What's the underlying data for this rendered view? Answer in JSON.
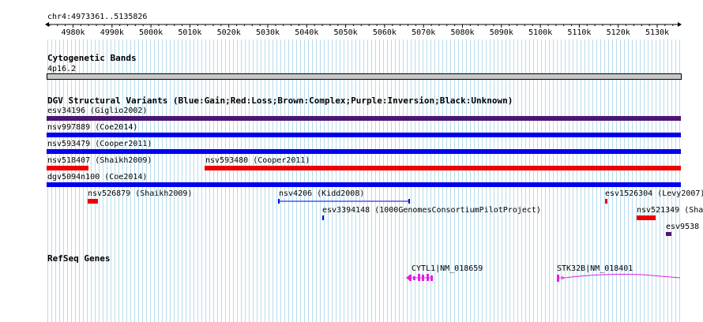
{
  "ruler": {
    "range_label": "chr4:4973361..5135826",
    "ticks": [
      "4980k",
      "4990k",
      "5000k",
      "5010k",
      "5020k",
      "5030k",
      "5040k",
      "5050k",
      "5060k",
      "5070k",
      "5080k",
      "5090k",
      "5100k",
      "5110k",
      "5120k",
      "5130k"
    ]
  },
  "cytoband": {
    "title": "Cytogenetic Bands",
    "band": "4p16.2"
  },
  "dgv": {
    "title": "DGV Structural Variants (Blue:Gain;Red:Loss;Brown:Complex;Purple:Inversion;Black:Unknown)",
    "variants": [
      {
        "label": "esv34196 (Giglio2002)",
        "color": "#4b1673"
      },
      {
        "label": "nsv997889 (Coe2014)",
        "color": "#0000ee"
      },
      {
        "label": "nsv593479 (Cooper2011)",
        "color": "#0000ee"
      },
      {
        "label": "nsv518407 (Shaikh2009)",
        "color": "#ee0000"
      },
      {
        "label": "nsv593480 (Cooper2011)",
        "color": "#ee0000"
      },
      {
        "label": "dgv5094n100 (Coe2014)",
        "color": "#0000ee"
      },
      {
        "label": "nsv526879 (Shaikh2009)",
        "color": "#ee0000"
      },
      {
        "label": "nsv4206 (Kidd2008)",
        "color": "#0000ee"
      },
      {
        "label": "esv1526304 (Levy2007)",
        "color": "#ee0000"
      },
      {
        "label": "esv3394148 (1000GenomesConsortiumPilotProject)",
        "color": "#0000ee"
      },
      {
        "label": "nsv521349 (Sha",
        "color": "#ee0000"
      },
      {
        "label": "esv9538",
        "color": "#4b1673"
      }
    ]
  },
  "refseq": {
    "title": "RefSeq Genes",
    "genes": [
      {
        "label": "CYTL1|NM_018659",
        "color": "#e020e0"
      },
      {
        "label": "STK32B|NM_018401",
        "color": "#e020e0"
      }
    ]
  },
  "colors": {
    "grid": "#b8dcec",
    "accent_magenta": "#e020e0"
  }
}
